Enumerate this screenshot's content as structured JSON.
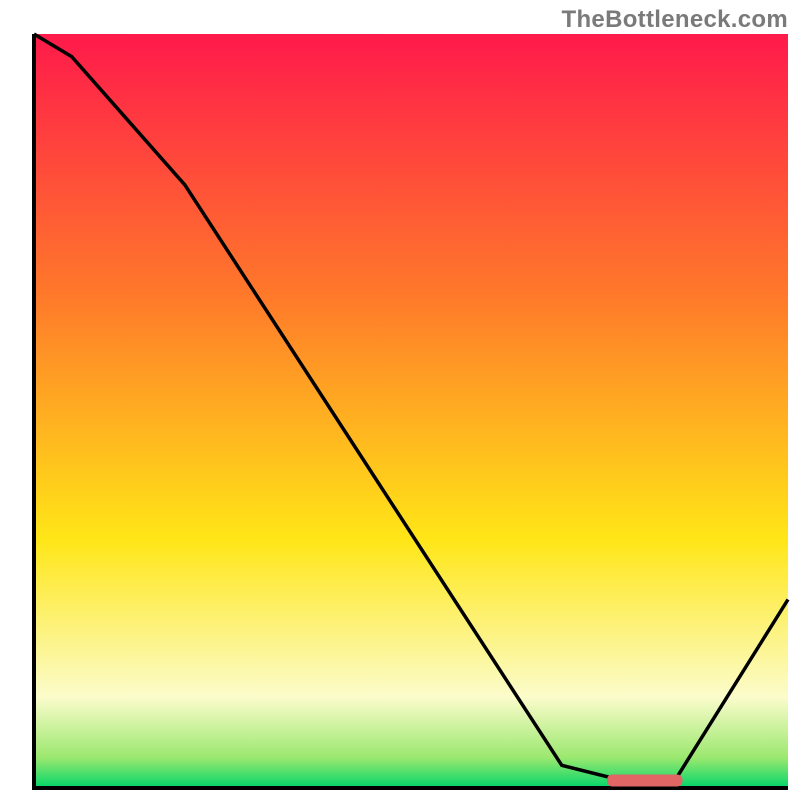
{
  "attribution": "TheBottleneck.com",
  "colors": {
    "red": "#ff1a4b",
    "orange": "#ff7a2a",
    "yellow": "#ffe617",
    "pale": "#fbfccb",
    "green1": "#9be86f",
    "green2": "#00d66a",
    "axis": "#000000",
    "line": "#000000",
    "marker": "#e06666"
  },
  "chart_data": {
    "type": "line",
    "title": "",
    "xlabel": "",
    "ylabel": "",
    "xlim": [
      0,
      100
    ],
    "ylim": [
      0,
      100
    ],
    "x": [
      0,
      5,
      20,
      70,
      78,
      85,
      100
    ],
    "y": [
      100,
      97,
      80,
      3,
      1,
      1,
      25
    ],
    "optimal_zone": {
      "x_start": 76,
      "x_end": 86,
      "y": 1
    }
  }
}
